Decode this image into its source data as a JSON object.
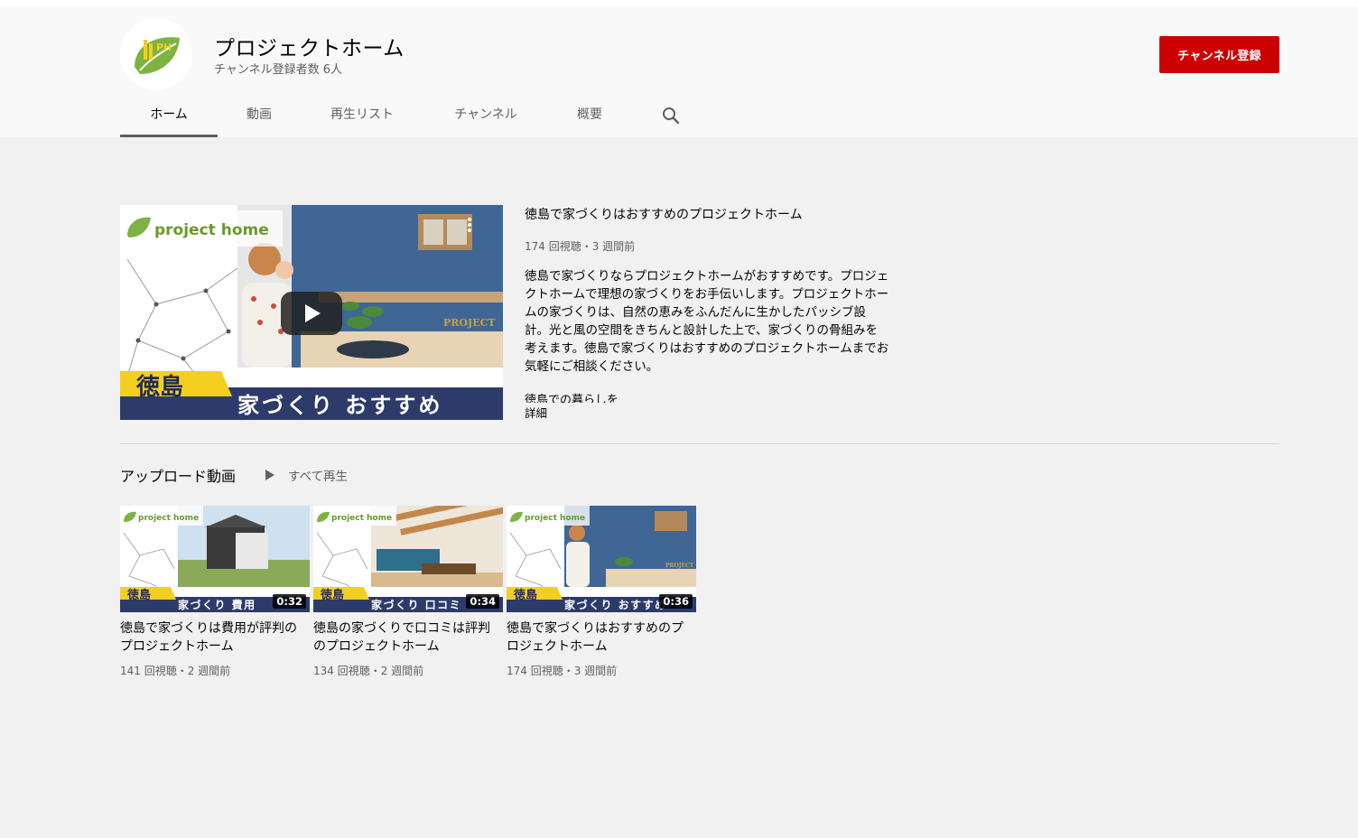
{
  "channel": {
    "name": "プロジェクトホーム",
    "subscribers": "チャンネル登録者数 6人",
    "subscribe_label": "チャンネル登録",
    "avatar_text": "PH"
  },
  "tabs": [
    {
      "label": "ホーム",
      "active": true
    },
    {
      "label": "動画"
    },
    {
      "label": "再生リスト"
    },
    {
      "label": "チャンネル"
    },
    {
      "label": "概要"
    }
  ],
  "featured": {
    "title": "徳島で家づくりはおすすめのプロジェクトホーム",
    "meta": "174 回視聴・3 週間前",
    "description": "徳島で家づくりならプロジェクトホームがおすすめです。プロジェクトホームで理想の家づくりをお手伝いします。プロジェクトホームの家づくりは、自然の恵みをふんだんに生かしたパッシブ設計。光と風の空間をきちんと設計した上で、家づくりの骨組みを考えます。徳島で家づくりはおすすめのプロジェクトホームまでお気軽にご相談ください。",
    "description_more": "徳島での暮らしを",
    "more_label": "詳細",
    "thumb_logo": "project home",
    "thumb_place": "徳島",
    "thumb_caption": "家づくり おすすめ",
    "thumb_sign": "PROJECT"
  },
  "uploads": {
    "title": "アップロード動画",
    "play_all": "すべて再生",
    "videos": [
      {
        "title": "徳島で家づくりは費用が評判のプロジェクトホーム",
        "meta": "141 回視聴・2 週間前",
        "duration": "0:32",
        "caption": "家づくり 費用",
        "place": "徳島",
        "logo": "project home"
      },
      {
        "title": "徳島の家づくりで口コミは評判のプロジェクトホーム",
        "meta": "134 回視聴・2 週間前",
        "duration": "0:34",
        "caption": "家づくり 口コミ",
        "place": "徳島",
        "logo": "project home"
      },
      {
        "title": "徳島で家づくりはおすすめのプロジェクトホーム",
        "meta": "174 回視聴・3 週間前",
        "duration": "0:36",
        "caption": "家づくり おすすめ",
        "place": "徳島",
        "logo": "project home"
      }
    ]
  },
  "colors": {
    "subscribe_red": "#cc0000",
    "thumb_navy": "#2d3b6b",
    "thumb_yellow": "#f3cf1f",
    "logo_green": "#7cb342",
    "wall_blue": "#3f6695"
  },
  "icons": {
    "search": "search-icon",
    "play": "play-icon",
    "menu": "more-vert-icon"
  }
}
